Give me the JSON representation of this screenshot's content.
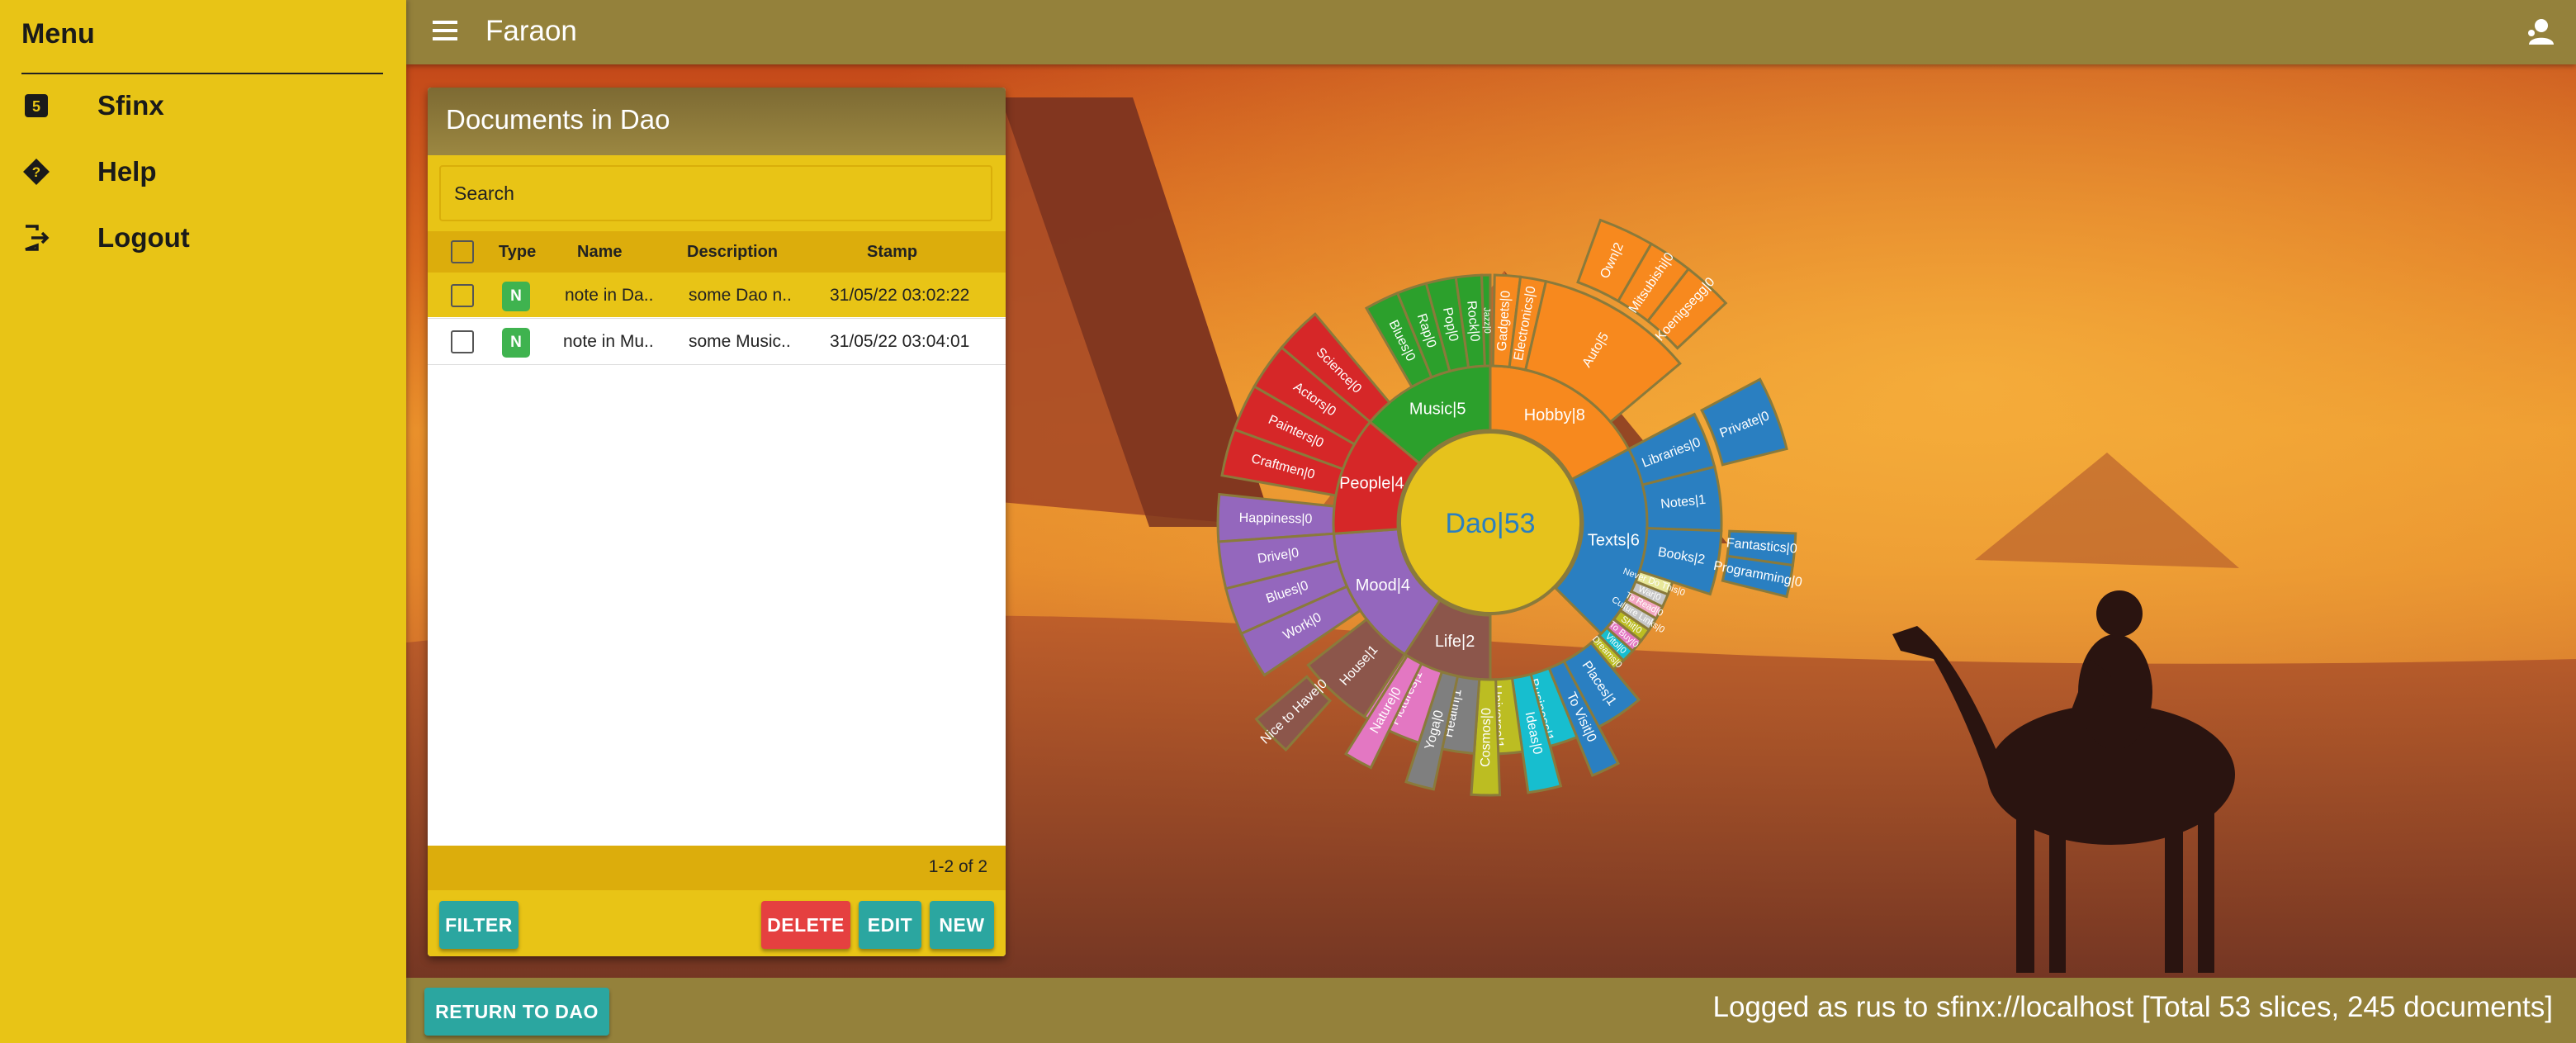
{
  "sidebar": {
    "title": "Menu",
    "items": [
      {
        "label": "Sfinx",
        "icon": "sfinx-icon"
      },
      {
        "label": "Help",
        "icon": "help-icon"
      },
      {
        "label": "Logout",
        "icon": "logout-icon"
      }
    ]
  },
  "topbar": {
    "title": "Faraon"
  },
  "panel": {
    "title": "Documents in Dao",
    "search_placeholder": "Search",
    "columns": [
      "Type",
      "Name",
      "Description",
      "Stamp"
    ],
    "rows": [
      {
        "type": "N",
        "name": "note in Da..",
        "description": "some Dao n..",
        "stamp": "31/05/22 03:02:22"
      },
      {
        "type": "N",
        "name": "note in Mu..",
        "description": "some Music..",
        "stamp": "31/05/22 03:04:01"
      }
    ],
    "pager": "1-2 of 2",
    "buttons": {
      "filter": "FILTER",
      "delete": "DELETE",
      "edit": "EDIT",
      "new": "NEW"
    }
  },
  "sunburst": {
    "center": "Dao|53",
    "inner": [
      {
        "label": "Hobby|8",
        "color": "#f7891e"
      },
      {
        "label": "Texts|6",
        "color": "#2a7fc1"
      },
      {
        "label": "Life|2",
        "color": "#8c564b"
      },
      {
        "label": "Mood|4",
        "color": "#9467bd"
      },
      {
        "label": "People|4",
        "color": "#d62728"
      },
      {
        "label": "Music|5",
        "color": "#2ca02c"
      }
    ],
    "outer": [
      {
        "label": "Gadgets|0"
      },
      {
        "label": "Electronics|0"
      },
      {
        "label": "Auto|5"
      },
      {
        "label": "Own|2"
      },
      {
        "label": "Mitsubishi|0"
      },
      {
        "label": "Koenigsegg|0"
      },
      {
        "label": "Libraries|0"
      },
      {
        "label": "Private|0"
      },
      {
        "label": "Notes|1"
      },
      {
        "label": "Books|2"
      },
      {
        "label": "Fantastics|0"
      },
      {
        "label": "Programming|0"
      },
      {
        "label": "Never Do This|0"
      },
      {
        "label": "War|0"
      },
      {
        "label": "To Read|0"
      },
      {
        "label": "Culture Links|0"
      },
      {
        "label": "Shit|0"
      },
      {
        "label": "To Buy|0"
      },
      {
        "label": "Vitol|0"
      },
      {
        "label": "Dreams|0"
      },
      {
        "label": "Places|1"
      },
      {
        "label": "To Visit|0"
      },
      {
        "label": "Business|1"
      },
      {
        "label": "Ideas|0"
      },
      {
        "label": "Universe|1"
      },
      {
        "label": "Cosmos|0"
      },
      {
        "label": "Health|1"
      },
      {
        "label": "Yoga|0"
      },
      {
        "label": "Pictures|1"
      },
      {
        "label": "Nature|0"
      },
      {
        "label": "House|1"
      },
      {
        "label": "Nice to Have|0"
      },
      {
        "label": "Happiness|0"
      },
      {
        "label": "Drive|0"
      },
      {
        "label": "Blues|0"
      },
      {
        "label": "Work|0"
      },
      {
        "label": "Science|0"
      },
      {
        "label": "Actors|0"
      },
      {
        "label": "Painters|0"
      },
      {
        "label": "Craftmen|0"
      },
      {
        "label": "Blues|0"
      },
      {
        "label": "Rap|0"
      },
      {
        "label": "Pop|0"
      },
      {
        "label": "Rock|0"
      },
      {
        "label": "Jazz|0"
      }
    ]
  },
  "bottombar": {
    "return_label": "RETURN TO DAO",
    "status": "Logged as rus to sfinx://localhost [Total 53 slices, 245 documents]"
  },
  "colors": {
    "sidebar": "#e8c416",
    "bar": "#94813b",
    "teal": "#2ba6a0",
    "red": "#e54040"
  }
}
